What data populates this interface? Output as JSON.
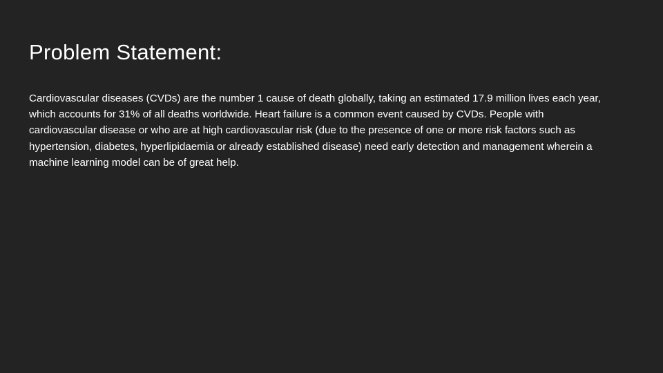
{
  "slide": {
    "title": "Problem Statement:",
    "body_lines": [
      "Cardiovascular diseases (CVDs) are the number 1 cause of death globally, taking an estimated 17.9 million lives each year,",
      "which accounts for 31% of all deaths worldwide. Heart failure is a common event caused by CVDs. People with",
      "cardiovascular disease or who are at high cardiovascular risk (due to the presence of one or more risk factors such as",
      "hypertension, diabetes, hyperlipidaemia or already established disease) need early detection and management wherein a",
      "machine learning model can be of great help."
    ]
  },
  "colors": {
    "background": "#232323",
    "text": "#ffffff"
  }
}
